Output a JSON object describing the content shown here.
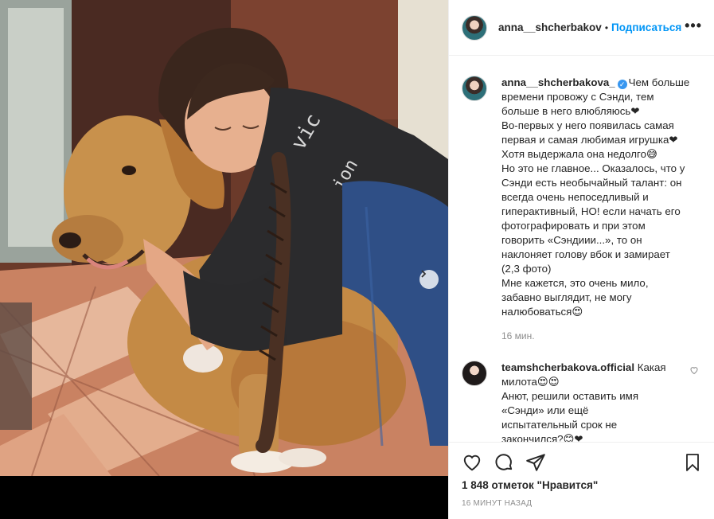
{
  "post": {
    "photo_alt": "",
    "next_icon": "chevron-right-icon"
  },
  "header": {
    "username": "anna__shcherbakov",
    "separator": "•",
    "follow_label": "Подписаться",
    "more_icon": "more-horizontal-icon",
    "more_glyph": "•••"
  },
  "caption": {
    "username": "anna__shcherbakova_",
    "verified": true,
    "lines": [
      "Чем больше",
      "времени провожу с Сэнди, тем",
      "больше в него влюбляюсь❤",
      "Во-первых у него появилась самая",
      "первая и самая любимая игрушка❤",
      "Хотя выдержала она недолго😅",
      "Но это не главное... Оказалось, что у",
      "Сэнди есть необычайный талант: он",
      "всегда очень непоседливый и",
      "гиперактивный, НО! если начать его",
      "фотографировать и при этом",
      "говорить «Сэндиии...», то он",
      "наклоняет голову вбок и замирает",
      "(2,3 фото)",
      "Мне кажется, это очень мило,",
      "забавно выглядит, не могу",
      "налюбоваться😍"
    ],
    "time": "16 мин."
  },
  "comment": {
    "username": "teamshcherbakova.official",
    "lines": [
      "Какая",
      "милота😍😍",
      "Анют, решили оставить имя",
      "«Сэнди» или ещё",
      "испытательный срок не",
      "закончился?😊❤"
    ]
  },
  "actions": {
    "like_icon": "heart-icon",
    "comment_icon": "comment-icon",
    "share_icon": "share-icon",
    "save_icon": "bookmark-icon",
    "likes_text": "1 848 отметок \"Нравится\"",
    "timestamp": "16 минут назад"
  },
  "colors": {
    "accent": "#0095f6",
    "text": "#262626",
    "muted": "#8e8e8e",
    "border": "#efefef"
  }
}
